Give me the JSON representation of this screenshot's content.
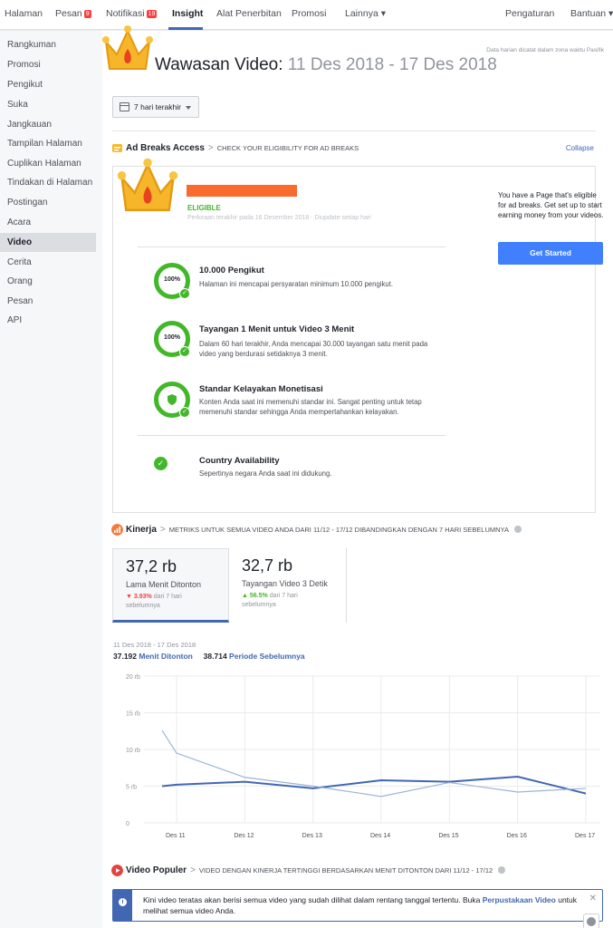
{
  "topnav": {
    "items": [
      "Halaman",
      "Pesan",
      "Notifikasi",
      "Insight",
      "Alat Penerbitan",
      "Promosi",
      "Lainnya ▾"
    ],
    "pesan_badge": "9",
    "notif_badge": "19",
    "right": [
      "Pengaturan",
      "Bantuan ▾"
    ]
  },
  "sidebar": {
    "items": [
      "Rangkuman",
      "Promosi",
      "Pengikut",
      "Suka",
      "Jangkauan",
      "Tampilan Halaman",
      "Cuplikan Halaman",
      "Tindakan di Halaman",
      "Postingan",
      "Acara",
      "Video",
      "Cerita",
      "Orang",
      "Pesan",
      "API"
    ],
    "active": "Video"
  },
  "header": {
    "timezone_note": "Data harian dicatat dalam zona waktu Pasifik",
    "title": "Wawasan Video:",
    "dates": "11 Des 2018 - 17 Des 2018",
    "date_button": "7 hari terakhir"
  },
  "ad_breaks": {
    "title": "Ad Breaks Access",
    "subtitle": "CHECK YOUR ELIGIBILITY FOR AD BREAKS",
    "collapse": "Collapse",
    "status": "ELIGIBLE",
    "estimate": "Perkiraan terakhir pada 16 Desember 2018 - Diupdate setiap hari",
    "requirements": [
      {
        "pct": "100%",
        "title": "10.000 Pengikut",
        "desc": "Halaman ini mencapai persyaratan minimum 10.000 pengikut."
      },
      {
        "pct": "100%",
        "title": "Tayangan 1 Menit untuk Video 3 Menit",
        "desc": "Dalam 60 hari terakhir, Anda mencapai 30.000 tayangan satu menit pada video yang berdurasi setidaknya 3 menit."
      },
      {
        "pct": "",
        "title": "Standar Kelayakan Monetisasi",
        "desc": "Konten Anda saat ini memenuhi standar ini. Sangat penting untuk tetap memenuhi standar sehingga Anda mempertahankan kelayakan."
      },
      {
        "pct": "",
        "title": "Country Availability",
        "desc": "Sepertinya negara Anda saat ini didukung."
      }
    ],
    "side_text": "You have a Page that's eligible for ad breaks. Get set up to start earning money from your videos.",
    "cta": "Get Started"
  },
  "kinerja": {
    "title": "Kinerja",
    "subtitle": "METRIKS UNTUK SEMUA VIDEO ANDA DARI 11/12 - 17/12 DIBANDINGKAN DENGAN 7 HARI SEBELUMNYA",
    "metrics": [
      {
        "value": "37,2 rb",
        "label": "Lama Menit Ditonton",
        "change": "3.93%",
        "change_suffix": "dari 7 hari sebelumnya"
      },
      {
        "value": "32,7 rb",
        "label": "Tayangan Video 3 Detik",
        "change": "56.5%",
        "change_suffix": "dari 7 hari sebelumnya"
      }
    ],
    "range": "11 Des 2018 - 17 Des 2018",
    "legend_current_value": "37.192",
    "legend_current_label": "Menit Ditonton",
    "legend_prev_value": "38.714",
    "legend_prev_label": "Periode Sebelumnya"
  },
  "chart_data": {
    "type": "line",
    "categories": [
      "Des 11",
      "Des 12",
      "Des 13",
      "Des 14",
      "Des 15",
      "Des 16",
      "Des 17"
    ],
    "y_ticks": [
      "0",
      "5 rb",
      "10 rb",
      "15 rb",
      "20 rb"
    ],
    "ylim": [
      0,
      20000
    ],
    "series": [
      {
        "name": "Menit Ditonton",
        "color": "#4267b2",
        "values": [
          5000,
          5600,
          4700,
          5800,
          5600,
          6300,
          4000
        ]
      },
      {
        "name": "Periode Sebelumnya",
        "color": "#9cb4d8",
        "values": [
          12600,
          6200,
          5000,
          3600,
          5500,
          4200,
          4700
        ]
      }
    ],
    "extra_prev_point": 9500
  },
  "populer": {
    "title": "Video Populer",
    "subtitle": "VIDEO DENGAN KINERJA TERTINGGI BERDASARKAN MENIT DITONTON DARI 11/12 - 17/12",
    "banner_pre": "Kini video teratas akan berisi semua video yang sudah dilihat dalam rentang tanggal tertentu. Buka",
    "banner_link": "Perpustakaan Video",
    "banner_post": "untuk melihat semua video Anda."
  },
  "colors": {
    "accent": "#4267b2",
    "eligible": "#42b72a",
    "orange": "#f96a2f"
  }
}
